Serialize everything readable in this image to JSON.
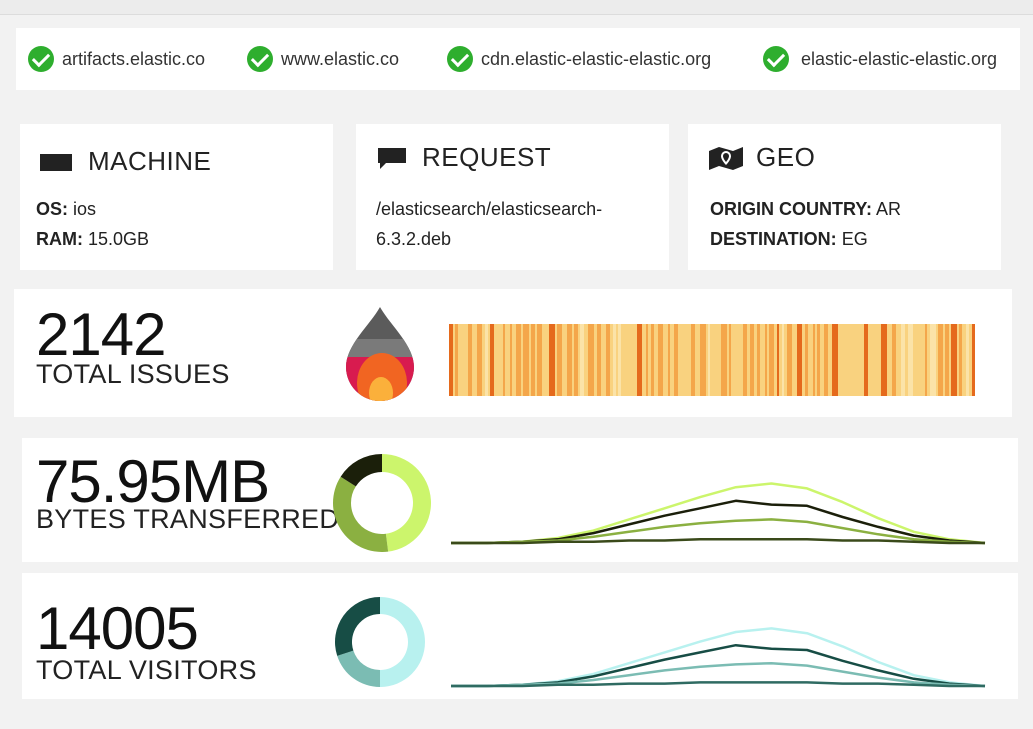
{
  "status": {
    "items": [
      {
        "host": "artifacts.elastic.co",
        "state": "ok"
      },
      {
        "host": "www.elastic.co",
        "state": "ok"
      },
      {
        "host": "cdn.elastic-elastic-elastic.org",
        "state": "ok"
      },
      {
        "host": "elastic-elastic-elastic.org",
        "state": "ok"
      }
    ],
    "ok_color": "#2eae2e"
  },
  "machine": {
    "title": "MACHINE",
    "icon": "monitor-icon",
    "os_label": "OS:",
    "os_value": "ios",
    "ram_label": "RAM:",
    "ram_value": "15.0GB"
  },
  "request": {
    "title": "REQUEST",
    "icon": "speech-bubble-icon",
    "path_line1": "/elasticsearch/elasticsearch-",
    "path_line2": "6.3.2.deb"
  },
  "geo": {
    "title": "GEO",
    "icon": "map-pin-icon",
    "origin_label": "ORIGIN COUNTRY:",
    "origin_value": "AR",
    "dest_label": "DESTINATION:",
    "dest_value": "EG"
  },
  "issues": {
    "value": "2142",
    "label": "TOTAL ISSUES",
    "icon": "flame-icon",
    "colors": [
      "#f9d27f",
      "#f4a64a",
      "#e56a1c",
      "#fbe3a8"
    ]
  },
  "bytes": {
    "value": "75.95MB",
    "label": "BYTES TRANSFERRED",
    "colors": {
      "light": "#ccf56c",
      "mid": "#8bb041",
      "dark": "#1b1f0a"
    }
  },
  "visitors": {
    "value": "14005",
    "label": "TOTAL VISITORS",
    "colors": {
      "light": "#b8f1ef",
      "mid": "#7bbcb3",
      "dark": "#174d45"
    }
  },
  "chart_data": [
    {
      "type": "pie",
      "values": [
        48,
        36,
        16
      ],
      "colors": [
        "#ccf56c",
        "#8bb041",
        "#1b1f0a"
      ]
    },
    {
      "type": "line",
      "x": [
        0,
        1,
        2,
        3,
        4,
        5,
        6,
        7,
        8,
        9,
        10,
        11,
        12,
        13,
        14,
        15
      ],
      "series": [
        {
          "values": [
            0,
            0,
            1,
            4,
            10,
            19,
            28,
            37,
            45,
            48,
            44,
            33,
            20,
            9,
            3,
            0
          ],
          "color": "#ccf56c"
        },
        {
          "values": [
            0,
            0,
            1,
            3,
            8,
            15,
            22,
            28,
            34,
            31,
            30,
            21,
            13,
            6,
            2,
            0
          ],
          "color": "#1b1f0a"
        },
        {
          "values": [
            0,
            0,
            1,
            2,
            5,
            9,
            13,
            16,
            18,
            19,
            17,
            12,
            7,
            3,
            1,
            0
          ],
          "color": "#8bb041"
        },
        {
          "values": [
            0,
            0,
            0,
            1,
            1,
            2,
            2,
            3,
            3,
            3,
            3,
            2,
            2,
            1,
            0,
            0
          ],
          "color": "#3a4a1a"
        }
      ]
    },
    {
      "type": "pie",
      "values": [
        50,
        20,
        30
      ],
      "colors": [
        "#b8f1ef",
        "#7bbcb3",
        "#174d45"
      ]
    },
    {
      "type": "line",
      "x": [
        0,
        1,
        2,
        3,
        4,
        5,
        6,
        7,
        8,
        9,
        10,
        11,
        12,
        13,
        14,
        15
      ],
      "series": [
        {
          "values": [
            0,
            0,
            1,
            4,
            10,
            19,
            28,
            37,
            45,
            48,
            44,
            33,
            20,
            9,
            3,
            0
          ],
          "color": "#b8f1ef"
        },
        {
          "values": [
            0,
            0,
            1,
            3,
            8,
            15,
            22,
            28,
            34,
            31,
            30,
            21,
            13,
            6,
            2,
            0
          ],
          "color": "#174d45"
        },
        {
          "values": [
            0,
            0,
            1,
            2,
            5,
            9,
            13,
            16,
            18,
            19,
            17,
            12,
            7,
            3,
            1,
            0
          ],
          "color": "#7bbcb3"
        },
        {
          "values": [
            0,
            0,
            0,
            1,
            1,
            2,
            2,
            3,
            3,
            3,
            3,
            2,
            2,
            1,
            0,
            0
          ],
          "color": "#2f6b62"
        }
      ]
    }
  ]
}
